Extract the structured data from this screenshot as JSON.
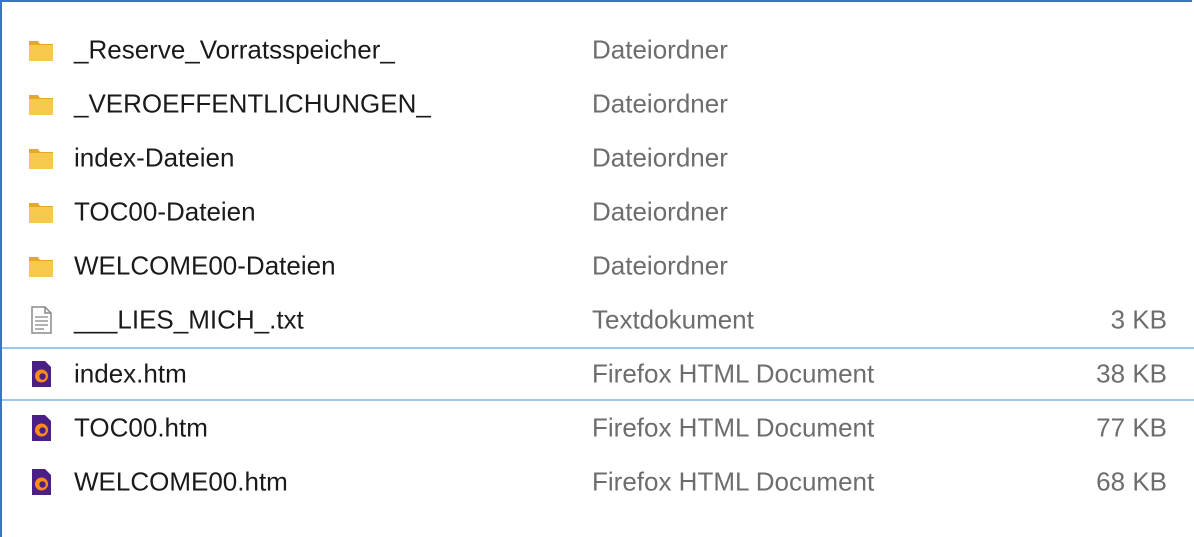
{
  "colors": {
    "folder": "#f6c94c",
    "folder_edge": "#e3aa2a",
    "selection_border": "#99c9ef",
    "window_border": "#3b73c9",
    "firefox_dark": "#4a1f86",
    "firefox_flame": "#ff8a1c"
  },
  "files": [
    {
      "name": "_Reserve_Vorratsspeicher_",
      "type": "Dateiordner",
      "size": "",
      "icon": "folder-icon"
    },
    {
      "name": "_VEROEFFENTLICHUNGEN_",
      "type": "Dateiordner",
      "size": "",
      "icon": "folder-icon"
    },
    {
      "name": "index-Dateien",
      "type": "Dateiordner",
      "size": "",
      "icon": "folder-icon"
    },
    {
      "name": "TOC00-Dateien",
      "type": "Dateiordner",
      "size": "",
      "icon": "folder-icon"
    },
    {
      "name": "WELCOME00-Dateien",
      "type": "Dateiordner",
      "size": "",
      "icon": "folder-icon"
    },
    {
      "name": "___LIES_MICH_.txt",
      "type": "Textdokument",
      "size": "3 KB",
      "icon": "text-file-icon"
    },
    {
      "name": "index.htm",
      "type": "Firefox HTML Document",
      "size": "38 KB",
      "icon": "firefox-document-icon",
      "focused": true
    },
    {
      "name": "TOC00.htm",
      "type": "Firefox HTML Document",
      "size": "77 KB",
      "icon": "firefox-document-icon"
    },
    {
      "name": "WELCOME00.htm",
      "type": "Firefox HTML Document",
      "size": "68 KB",
      "icon": "firefox-document-icon"
    }
  ]
}
